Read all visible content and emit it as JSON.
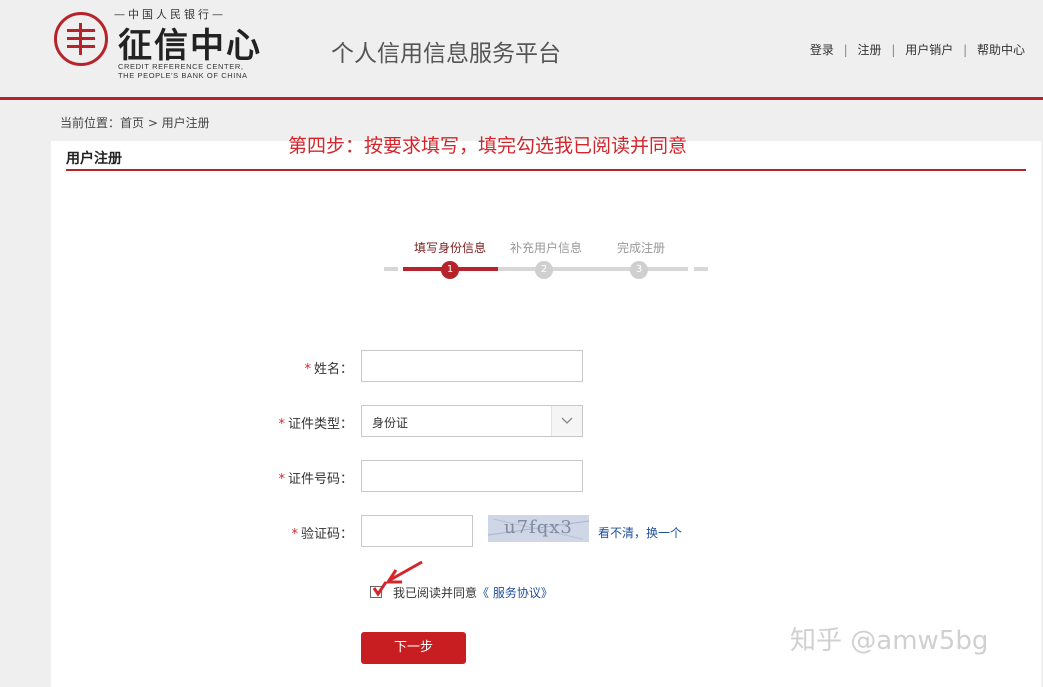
{
  "header": {
    "logo_top": "—中国人民银行—",
    "logo_main": "征信中心",
    "logo_en_line1": "CREDIT REFERENCE CENTER,",
    "logo_en_line2": "THE PEOPLE'S BANK OF CHINA",
    "platform_title": "个人信用信息服务平台",
    "nav": [
      "登录",
      "注册",
      "用户销户",
      "帮助中心"
    ],
    "nav_sep": "|"
  },
  "breadcrumb": "当前位置：首页 > 用户注册",
  "annotation": "第四步：按要求填写，填完勾选我已阅读并同意",
  "panel_title": "用户注册",
  "steps": [
    {
      "label": "填写身份信息",
      "number": "1",
      "active": true
    },
    {
      "label": "补充用户信息",
      "number": "2",
      "active": false
    },
    {
      "label": "完成注册",
      "number": "3",
      "active": false
    }
  ],
  "form": {
    "required_mark": "*",
    "name_label": "姓名：",
    "name_value": "",
    "id_type_label": "证件类型：",
    "id_type_value": "身份证",
    "id_number_label": "证件号码：",
    "id_number_value": "",
    "captcha_label": "验证码：",
    "captcha_value": "",
    "captcha_image_text": "u7fqx3",
    "refresh_text": "看不清，换一个",
    "agree_text": "我已阅读并同意",
    "agree_link": "《 服务协议》",
    "next_button": "下一步"
  },
  "watermark": "知乎 @amw5bg",
  "colors": {
    "brand_red": "#b7232a",
    "button_red": "#c81e22",
    "annotation_red": "#d4252b",
    "link_blue": "#1e4f9c"
  }
}
